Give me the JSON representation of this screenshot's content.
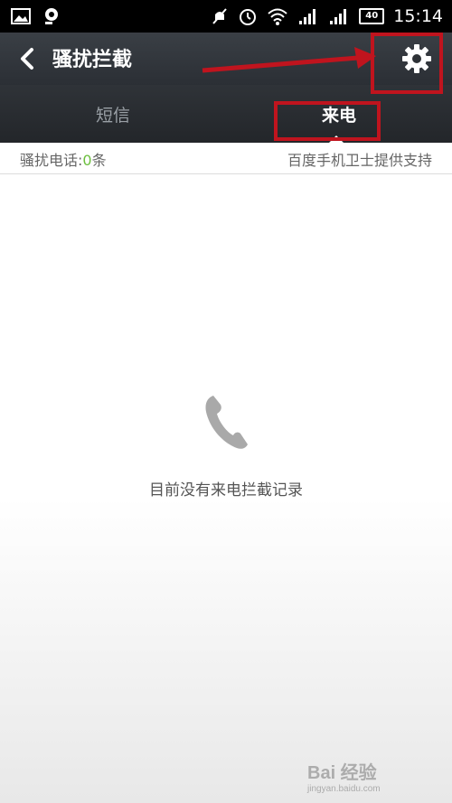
{
  "status_bar": {
    "time": "15:14",
    "battery": "40",
    "icons": [
      "image-icon",
      "location-icon",
      "muted-icon",
      "alarm-icon",
      "wifi-icon",
      "signal-icon",
      "signal-icon"
    ]
  },
  "header": {
    "title": "骚扰拦截",
    "back_icon": "back-arrow-icon",
    "settings_icon": "gear-icon"
  },
  "tabs": [
    {
      "label": "短信",
      "active": false
    },
    {
      "label": "来电",
      "active": true
    }
  ],
  "info": {
    "label": "骚扰电话:",
    "count": "0",
    "unit": "条",
    "support_text": "百度手机卫士提供支持"
  },
  "empty_state": {
    "icon": "phone-icon",
    "message": "目前没有来电拦截记录"
  },
  "watermark": {
    "main": "Bai 经验",
    "sub": "jingyan.baidu.com"
  },
  "colors": {
    "header_bg": "#2b2f35",
    "accent_green": "#6cbf3e",
    "annotation_red": "#c0141e"
  }
}
